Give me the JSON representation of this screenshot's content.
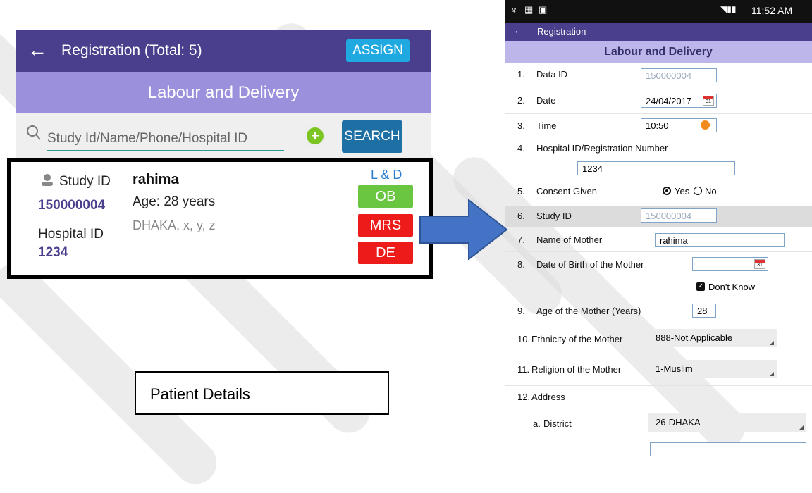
{
  "left": {
    "back_glyph": "←",
    "title": "Registration  (Total: 5)",
    "assign_label": "ASSIGN",
    "subheader": "Labour and Delivery",
    "search_placeholder": "Study Id/Name/Phone/Hospital ID",
    "search_label": "SEARCH",
    "card": {
      "study_id_label": "Study ID",
      "study_id": "150000004",
      "hospital_id_label": "Hospital ID",
      "hospital_id": "1234",
      "name": "rahima",
      "age": "Age: 28 years",
      "address": "DHAKA, x, y, z",
      "section_label": "L & D",
      "badges": [
        "OB",
        "MRS",
        "DE"
      ]
    },
    "patient_details_label": "Patient Details"
  },
  "right": {
    "status_time": "11:52 AM",
    "title": "Registration",
    "subheader": "Labour and Delivery",
    "rows": {
      "r1": {
        "num": "1.",
        "label": "Data ID",
        "value": "150000004"
      },
      "r2": {
        "num": "2.",
        "label": "Date",
        "value": "24/04/2017"
      },
      "r3": {
        "num": "3.",
        "label": "Time",
        "value": "10:50"
      },
      "r4": {
        "num": "4.",
        "label": "Hospital ID/Registration Number",
        "value": "1234"
      },
      "r5": {
        "num": "5.",
        "label": "Consent Given",
        "yes": "Yes",
        "no": "No"
      },
      "r6": {
        "num": "6.",
        "label": "Study ID",
        "value": "150000004"
      },
      "r7": {
        "num": "7.",
        "label": "Name of Mother",
        "value": "rahima"
      },
      "r8": {
        "num": "8.",
        "label": "Date of Birth of the Mother",
        "dont_know": "Don't Know"
      },
      "r9": {
        "num": "9.",
        "label": "Age of the Mother (Years)",
        "value": "28"
      },
      "r10": {
        "num": "10.",
        "label": "Ethnicity of the Mother",
        "value": "888-Not Applicable"
      },
      "r11": {
        "num": "11.",
        "label": "Religion of the Mother",
        "value": "1-Muslim"
      },
      "r12": {
        "num": "12.",
        "label": "Address"
      },
      "r12a": {
        "num": "a.",
        "label": "District",
        "value": "26-DHAKA"
      }
    }
  }
}
